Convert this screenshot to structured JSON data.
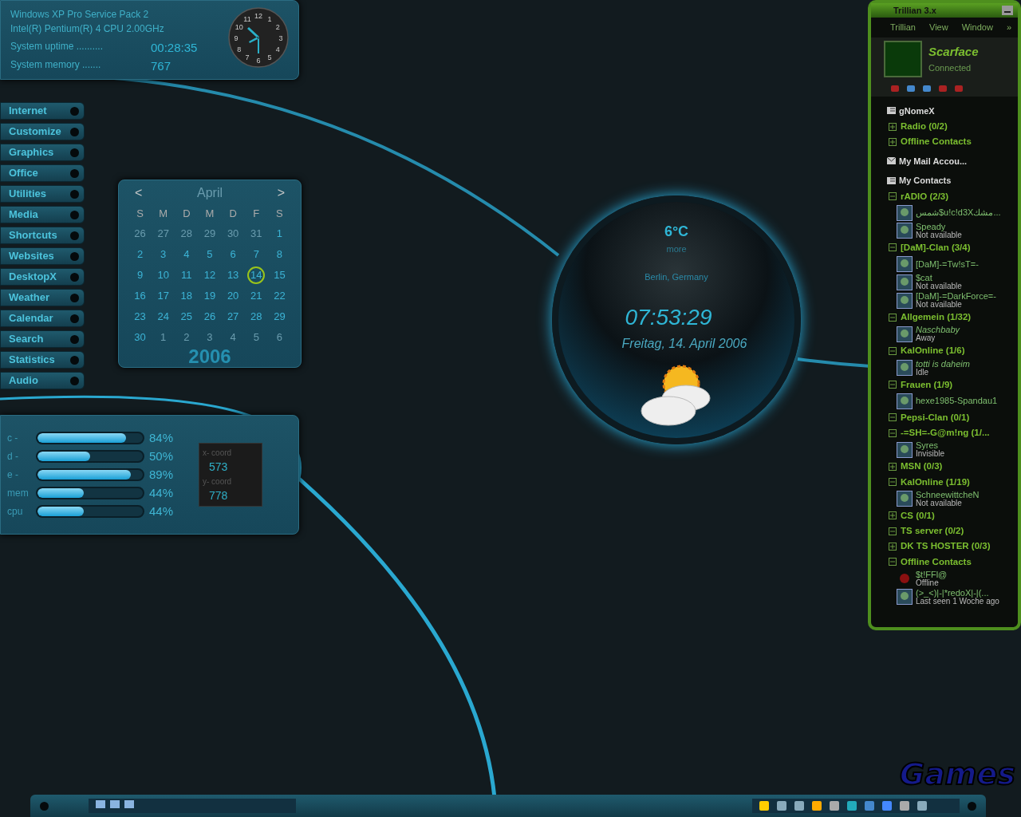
{
  "system_info": {
    "os": "Windows XP Pro Service Pack 2",
    "cpu": "Intel(R) Pentium(R) 4 CPU 2.00GHz",
    "stats": [
      {
        "label": "System uptime ..........",
        "value": "00:28:35"
      },
      {
        "label": "System memory .......",
        "value": "767"
      }
    ]
  },
  "clock": {
    "numerals": [
      "11",
      "12",
      "1",
      "10",
      "2",
      "9",
      "3",
      "8",
      "4",
      "7",
      "5",
      "6"
    ]
  },
  "launcher": [
    "Internet",
    "Customize",
    "Graphics",
    "Office",
    "Utilities",
    "Media",
    "Shortcuts",
    "Websites",
    "DesktopX",
    "Weather",
    "Calendar",
    "Search",
    "Statistics",
    "Audio"
  ],
  "calendar": {
    "prev": "<",
    "month": "April",
    "next": ">",
    "weekdays": [
      "S",
      "M",
      "D",
      "M",
      "D",
      "F",
      "S"
    ],
    "days": [
      {
        "label": "26",
        "current": false,
        "selected": false
      },
      {
        "label": "27",
        "current": false,
        "selected": false
      },
      {
        "label": "28",
        "current": false,
        "selected": false
      },
      {
        "label": "29",
        "current": false,
        "selected": false
      },
      {
        "label": "30",
        "current": false,
        "selected": false
      },
      {
        "label": "31",
        "current": false,
        "selected": false
      },
      {
        "label": "1",
        "current": true,
        "selected": false
      },
      {
        "label": "2",
        "current": true,
        "selected": false
      },
      {
        "label": "3",
        "current": true,
        "selected": false
      },
      {
        "label": "4",
        "current": true,
        "selected": false
      },
      {
        "label": "5",
        "current": true,
        "selected": false
      },
      {
        "label": "6",
        "current": true,
        "selected": false
      },
      {
        "label": "7",
        "current": true,
        "selected": false
      },
      {
        "label": "8",
        "current": true,
        "selected": false
      },
      {
        "label": "9",
        "current": true,
        "selected": false
      },
      {
        "label": "10",
        "current": true,
        "selected": false
      },
      {
        "label": "11",
        "current": true,
        "selected": false
      },
      {
        "label": "12",
        "current": true,
        "selected": false
      },
      {
        "label": "13",
        "current": true,
        "selected": false
      },
      {
        "label": "14",
        "current": true,
        "selected": true
      },
      {
        "label": "15",
        "current": true,
        "selected": false
      },
      {
        "label": "16",
        "current": true,
        "selected": false
      },
      {
        "label": "17",
        "current": true,
        "selected": false
      },
      {
        "label": "18",
        "current": true,
        "selected": false
      },
      {
        "label": "19",
        "current": true,
        "selected": false
      },
      {
        "label": "20",
        "current": true,
        "selected": false
      },
      {
        "label": "21",
        "current": true,
        "selected": false
      },
      {
        "label": "22",
        "current": true,
        "selected": false
      },
      {
        "label": "23",
        "current": true,
        "selected": false
      },
      {
        "label": "24",
        "current": true,
        "selected": false
      },
      {
        "label": "25",
        "current": true,
        "selected": false
      },
      {
        "label": "26",
        "current": true,
        "selected": false
      },
      {
        "label": "27",
        "current": true,
        "selected": false
      },
      {
        "label": "28",
        "current": true,
        "selected": false
      },
      {
        "label": "29",
        "current": true,
        "selected": false
      },
      {
        "label": "30",
        "current": true,
        "selected": false
      },
      {
        "label": "1",
        "current": false,
        "selected": false
      },
      {
        "label": "2",
        "current": false,
        "selected": false
      },
      {
        "label": "3",
        "current": false,
        "selected": false
      },
      {
        "label": "4",
        "current": false,
        "selected": false
      },
      {
        "label": "5",
        "current": false,
        "selected": false
      },
      {
        "label": "6",
        "current": false,
        "selected": false
      }
    ],
    "year": "2006"
  },
  "drive_meters": [
    {
      "label": "c -",
      "level": 0.84,
      "reading": "84%"
    },
    {
      "label": "d -",
      "level": 0.5,
      "reading": "50%"
    },
    {
      "label": "e -",
      "level": 0.89,
      "reading": "89%"
    },
    {
      "label": "mem",
      "level": 0.44,
      "reading": "44%"
    },
    {
      "label": "cpu",
      "level": 0.44,
      "reading": "44%"
    }
  ],
  "mouse_coords": [
    {
      "label": "x- coord",
      "value": "573"
    },
    {
      "label": "y- coord",
      "value": "778"
    }
  ],
  "weather": {
    "temperature": "6°C",
    "more": "more",
    "location": "Berlin, Germany",
    "time": "07:53:29",
    "date": "Freitag, 14. April 2006"
  },
  "trillian": {
    "title": "Trillian 3.x",
    "menu": [
      "Trillian",
      "View",
      "Window",
      "»"
    ],
    "user": {
      "name": "Scarface",
      "status": "Connected"
    },
    "sections": [
      {
        "title": "gNomeX",
        "kind": "contacts",
        "groups": [
          {
            "name": "Radio  (0/2)",
            "expanded": false
          },
          {
            "name": "Offline Contacts",
            "expanded": false
          }
        ]
      },
      {
        "title": "My Mail Accou...",
        "kind": "mail"
      },
      {
        "title": "My Contacts",
        "kind": "contacts",
        "groups": [
          {
            "name": "rADIO (2/3)",
            "expanded": true,
            "contacts": [
              {
                "name": "شمس$u!c!d3Xمشك...",
                "kind": "online"
              },
              {
                "name": "Speady",
                "status": "Not available",
                "kind": "online"
              }
            ]
          },
          {
            "name": "[DaM]-Clan (3/4)",
            "expanded": true,
            "contacts": [
              {
                "name": "[DaM]-=Tw!sT=-",
                "kind": "online"
              },
              {
                "name": "$cat",
                "status": "Not available",
                "kind": "online"
              },
              {
                "name": "[DaM]-=DarkForce=-",
                "status": "Not available",
                "kind": "online"
              }
            ]
          },
          {
            "name": "Allgemein (1/32)",
            "expanded": true,
            "contacts": [
              {
                "name": "Naschbaby",
                "status": "Away",
                "kind": "away"
              }
            ]
          },
          {
            "name": "KalOnline (1/6)",
            "expanded": true,
            "contacts": [
              {
                "name": "totti is daheim",
                "status": "Idle",
                "kind": "away"
              }
            ]
          },
          {
            "name": "Frauen (1/9)",
            "expanded": true,
            "contacts": [
              {
                "name": "hexe1985-Spandau1",
                "kind": "online"
              }
            ]
          },
          {
            "name": "Pepsi-Clan (0/1)",
            "expanded": true
          },
          {
            "name": "-=SH=-G@m!ng (1/...",
            "expanded": true,
            "contacts": [
              {
                "name": "Syres",
                "status": "Invisible",
                "kind": "online"
              }
            ]
          },
          {
            "name": "MSN (0/3)",
            "expanded": false
          },
          {
            "name": "KalOnline (1/19)",
            "expanded": true,
            "contacts": [
              {
                "name": "SchneewittcheN",
                "status": "Not available",
                "kind": "online"
              }
            ]
          },
          {
            "name": "CS (0/1)",
            "expanded": false
          },
          {
            "name": "TS server (0/2)",
            "expanded": true
          },
          {
            "name": "DK TS HOSTER (0/3)",
            "expanded": false
          },
          {
            "name": "Offline Contacts",
            "expanded": true,
            "contacts": [
              {
                "name": "$t!FFl@",
                "status": "Offline",
                "kind": "offline"
              },
              {
                "name": "(>_<)|-|*redoX|-|(...",
                "status": "Last seen 1 Woche ago",
                "kind": "online"
              }
            ]
          }
        ]
      }
    ]
  },
  "logo": "Games"
}
